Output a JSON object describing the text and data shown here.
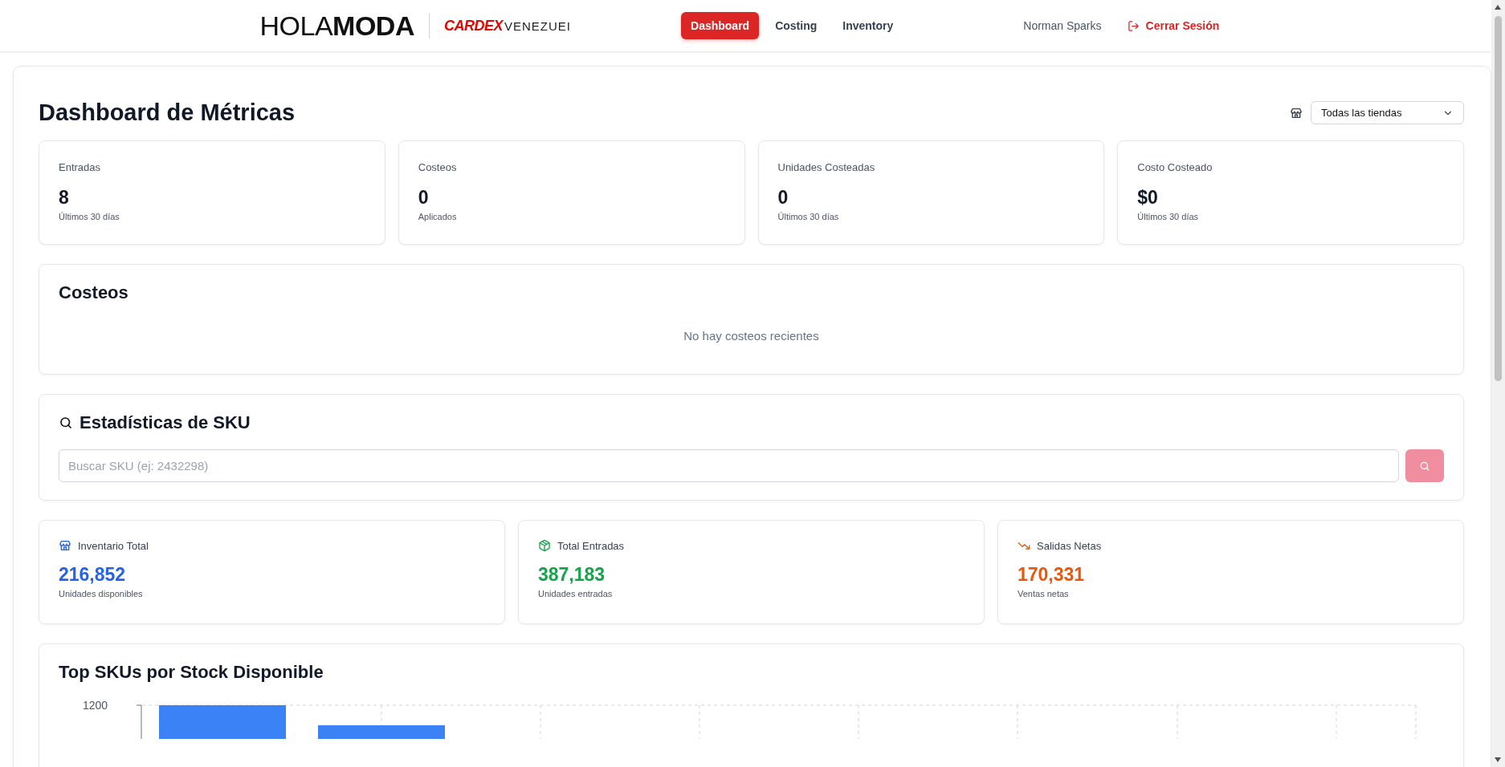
{
  "header": {
    "logo": "HOLA**MODA**",
    "brand": "CARDEX",
    "brand_suffix": "VENEZUEI",
    "nav": [
      {
        "label": "Dashboard",
        "selected": true
      },
      {
        "label": "Costing",
        "selected": false
      },
      {
        "label": "Inventory",
        "selected": false
      }
    ],
    "user": "Norman Sparks",
    "logout": "Cerrar Sesión"
  },
  "title": "Dashboard de Métricas",
  "store_filter": {
    "value": "Todas las tiendas"
  },
  "stats": [
    {
      "label": "Entradas",
      "value": "8",
      "caption": "Últimos 30 días"
    },
    {
      "label": "Costeos",
      "value": "0",
      "caption": "Aplicados"
    },
    {
      "label": "Unidades Costeadas",
      "value": "0",
      "caption": "Últimos 30 días"
    },
    {
      "label": "Costo Costeado",
      "value": "$0",
      "caption": "Últimos 30 días"
    }
  ],
  "costeos": {
    "title": "Costeos",
    "empty": "No hay costeos recientes"
  },
  "sku_stats": {
    "title": "Estadísticas de SKU",
    "search": {
      "placeholder": "Buscar SKU (ej: 2432298)"
    }
  },
  "metrics": [
    {
      "kind": "store",
      "label": "Inventario Total",
      "value": "216,852",
      "caption": "Unidades disponibles",
      "color": "#2563eb"
    },
    {
      "kind": "box",
      "label": "Total Entradas",
      "value": "387,183",
      "caption": "Unidades entradas",
      "color": "#16a34a"
    },
    {
      "kind": "trend-down",
      "label": "Salidas Netas",
      "value": "170,331",
      "caption": "Ventas netas",
      "color": "#ea580c"
    }
  ],
  "chart": {
    "title": "Top SKUs por Stock Disponible",
    "y_tick": "1200"
  }
}
